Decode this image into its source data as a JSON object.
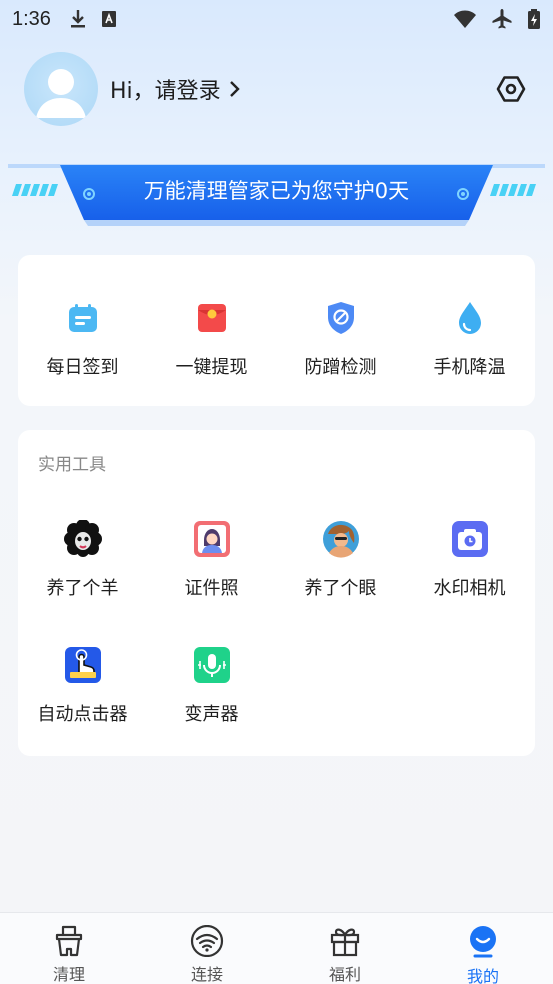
{
  "status_bar": {
    "time": "1:36"
  },
  "header": {
    "greeting": "Hi，请登录"
  },
  "banner": {
    "text": "万能清理管家已为您守护0天"
  },
  "quick_actions": [
    {
      "label": "每日签到",
      "icon": "calendar-icon"
    },
    {
      "label": "一键提现",
      "icon": "red-envelope-icon"
    },
    {
      "label": "防蹭检测",
      "icon": "shield-icon"
    },
    {
      "label": "手机降温",
      "icon": "water-drop-icon"
    }
  ],
  "tools": {
    "title": "实用工具",
    "items": [
      {
        "label": "养了个羊",
        "icon": "sheep-icon"
      },
      {
        "label": "证件照",
        "icon": "id-photo-icon"
      },
      {
        "label": "养了个眼",
        "icon": "portrait-icon"
      },
      {
        "label": "水印相机",
        "icon": "camera-icon"
      },
      {
        "label": "自动点击器",
        "icon": "auto-clicker-icon"
      },
      {
        "label": "变声器",
        "icon": "microphone-icon"
      }
    ]
  },
  "tabbar": {
    "tabs": [
      {
        "label": "清理",
        "icon": "broom-icon"
      },
      {
        "label": "连接",
        "icon": "wifi-icon"
      },
      {
        "label": "福利",
        "icon": "gift-icon"
      },
      {
        "label": "我的",
        "icon": "profile-icon",
        "active": true
      }
    ]
  },
  "colors": {
    "accent": "#1a73f5",
    "banner": "#1e6ff0"
  }
}
